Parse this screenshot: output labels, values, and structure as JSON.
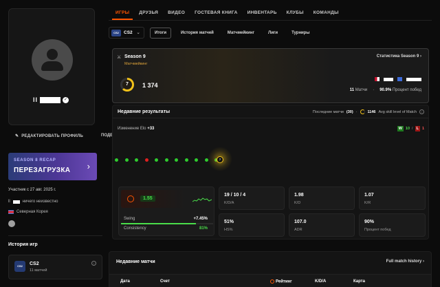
{
  "profile": {
    "username_prefix": "ll",
    "edit_label": "РЕДАКТИРОВАТЬ ПРОФИЛЬ",
    "edit_label_clipped": "ПОДЕ",
    "member_since": "Участник с 27 авг. 2025 г.",
    "bio_suffix": "ничего неизвестно",
    "bio_prefix": "ll",
    "country": "Северная Корея"
  },
  "recap": {
    "subtitle": "SEASON 8 RECAP",
    "title": "ПЕРЕЗАГРУЗКА",
    "arrow": "›"
  },
  "game_history": {
    "title": "История игр",
    "items": [
      {
        "icon": "CS2",
        "name": "CS2",
        "matches": "11 матчей"
      }
    ]
  },
  "nav": {
    "tabs": [
      "ИГРЫ",
      "ДРУЗЬЯ",
      "ВИДЕО",
      "ГОСТЕВАЯ КНИГА",
      "ИНВЕНТАРЬ",
      "КЛУБЫ",
      "КОМАНДЫ"
    ],
    "active": 0
  },
  "game_selector": {
    "badge": "CS2",
    "label": "CS2",
    "chevron": "⌄"
  },
  "subtabs": [
    "Итоги",
    "История матчей",
    "Матчмейкинг",
    "Лиги",
    "Турниры"
  ],
  "season": {
    "name": "Season 9",
    "mode": "Матчмейкинг",
    "stats_link": "Статистика Season 9  ›",
    "level": "7",
    "level_progress": 0.62,
    "elo": "1 374",
    "matches_count": "11",
    "matches_label": "Матчи",
    "winrate": "90.9%",
    "winrate_label": "Процент побед"
  },
  "results": {
    "title": "Недавние результаты",
    "last_label": "Последние матчи",
    "last_count": "(30)",
    "avg_value": "1146",
    "avg_label": "Avg skill level of Match",
    "elo_change_label": "Изменение Elo",
    "elo_change_value": "+33",
    "wins_badge": "W",
    "wins": "10",
    "losses_badge": "L",
    "losses": "1",
    "sequence": [
      "W",
      "W",
      "W",
      "L",
      "W",
      "W",
      "W",
      "W",
      "W",
      "W",
      "W"
    ],
    "current_level": "7",
    "colors": {
      "win": "#2fcc2f",
      "loss": "#e02020",
      "accent": "#ff5500",
      "level": "#f2c21a"
    }
  },
  "hero": {
    "rating": "1.55",
    "swing_label": "Swing",
    "swing_value": "+7.45%",
    "consistency_label": "Consistency",
    "consistency_value": "81%",
    "consistency_fraction": 0.81
  },
  "stats": [
    {
      "value": "19 / 10 / 4",
      "label": "K/D/A"
    },
    {
      "value": "1.98",
      "label": "K/D"
    },
    {
      "value": "1.07",
      "label": "K/R"
    },
    {
      "value": "51%",
      "label": "HS%"
    },
    {
      "value": "107.0",
      "label": "ADR"
    },
    {
      "value": "90%",
      "label": "Процент побед"
    }
  ],
  "matches": {
    "title": "Недавние матчи",
    "link": "Full match history  ›",
    "columns": [
      "Дата",
      "Счет",
      "Рейтинг",
      "K/D/A",
      "Карта"
    ]
  }
}
